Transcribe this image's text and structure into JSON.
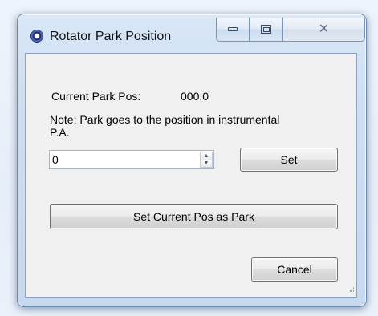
{
  "window": {
    "title": "Rotator Park Position",
    "minimize_label": "",
    "maximize_label": "",
    "close_glyph": "✕"
  },
  "dialog": {
    "current_park_label": "Current Park Pos:",
    "current_park_value": "000.0",
    "note": "Note: Park goes to the position in instrumental P.A.",
    "position_input_value": "0",
    "spin_up_glyph": "▲",
    "spin_down_glyph": "▼",
    "set_button": "Set",
    "set_current_button": "Set Current Pos as Park",
    "cancel_button": "Cancel"
  },
  "icons": {
    "app": "rotator-app-icon",
    "minimize": "minimize-icon",
    "maximize": "maximize-icon",
    "close": "close-icon",
    "resize": "resize-grip-icon"
  }
}
